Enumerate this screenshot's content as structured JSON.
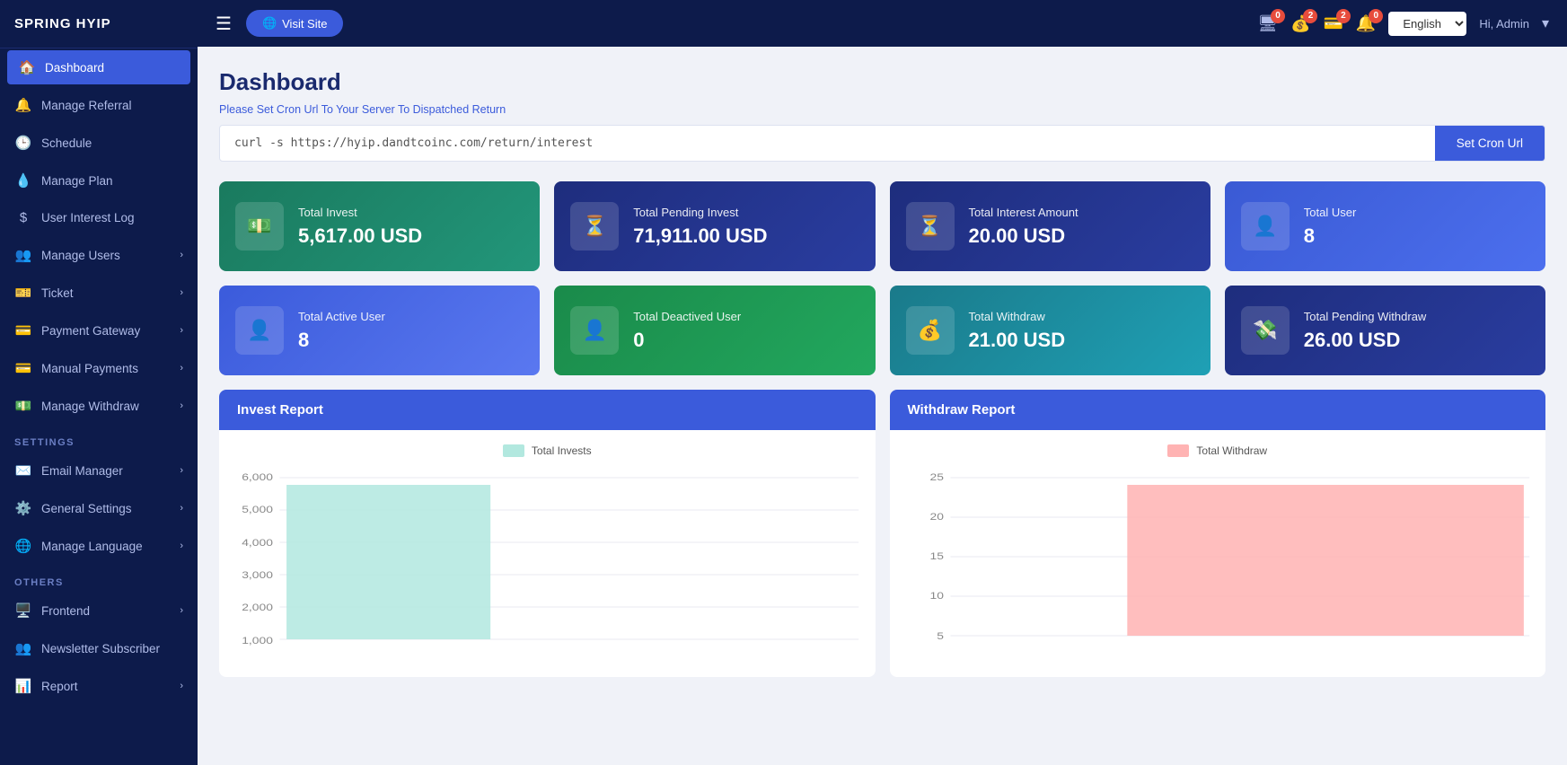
{
  "app": {
    "logo": "SPRING HYIP"
  },
  "sidebar": {
    "items": [
      {
        "id": "dashboard",
        "label": "Dashboard",
        "icon": "🏠",
        "active": true,
        "hasArrow": false
      },
      {
        "id": "manage-referral",
        "label": "Manage Referral",
        "icon": "🔔",
        "active": false,
        "hasArrow": false
      },
      {
        "id": "schedule",
        "label": "Schedule",
        "icon": "🕒",
        "active": false,
        "hasArrow": false
      },
      {
        "id": "manage-plan",
        "label": "Manage Plan",
        "icon": "💧",
        "active": false,
        "hasArrow": false
      },
      {
        "id": "user-interest-log",
        "label": "User Interest Log",
        "icon": "$",
        "active": false,
        "hasArrow": false
      },
      {
        "id": "manage-users",
        "label": "Manage Users",
        "icon": "👥",
        "active": false,
        "hasArrow": true
      },
      {
        "id": "ticket",
        "label": "Ticket",
        "icon": "🎫",
        "active": false,
        "hasArrow": true
      },
      {
        "id": "payment-gateway",
        "label": "Payment Gateway",
        "icon": "💳",
        "active": false,
        "hasArrow": true
      },
      {
        "id": "manual-payments",
        "label": "Manual Payments",
        "icon": "💳",
        "active": false,
        "hasArrow": true
      },
      {
        "id": "manage-withdraw",
        "label": "Manage Withdraw",
        "icon": "💵",
        "active": false,
        "hasArrow": true
      }
    ],
    "settings_label": "SETTINGS",
    "settings_items": [
      {
        "id": "email-manager",
        "label": "Email Manager",
        "icon": "✉️",
        "hasArrow": true
      },
      {
        "id": "general-settings",
        "label": "General Settings",
        "icon": "⚙️",
        "hasArrow": true
      },
      {
        "id": "manage-language",
        "label": "Manage Language",
        "icon": "🌐",
        "hasArrow": true
      }
    ],
    "others_label": "OTHERS",
    "others_items": [
      {
        "id": "frontend",
        "label": "Frontend",
        "icon": "🖥️",
        "hasArrow": true
      },
      {
        "id": "newsletter-subscriber",
        "label": "Newsletter Subscriber",
        "icon": "👥",
        "hasArrow": false
      },
      {
        "id": "report",
        "label": "Report",
        "icon": "📊",
        "hasArrow": true
      }
    ]
  },
  "topbar": {
    "visit_site_label": "Visit Site",
    "lang": "English",
    "admin_label": "Hi, Admin",
    "badges": {
      "monitor": 0,
      "wallet": 2,
      "card": 2,
      "bell": 0
    }
  },
  "content": {
    "page_title": "Dashboard",
    "cron_notice": "Please Set Cron Url To Your Server To Dispatched Return",
    "cron_command": "curl -s https://hyip.dandtcoinc.com/return/interest",
    "set_cron_label": "Set Cron Url",
    "stats": [
      {
        "id": "total-invest",
        "label": "Total Invest",
        "value": "5,617.00 USD",
        "icon": "💵",
        "color": "green"
      },
      {
        "id": "total-pending-invest",
        "label": "Total Pending Invest",
        "value": "71,911.00 USD",
        "icon": "⏳",
        "color": "dark-blue"
      },
      {
        "id": "total-interest-amount",
        "label": "Total Interest Amount",
        "value": "20.00 USD",
        "icon": "⏳",
        "color": "dark-blue"
      },
      {
        "id": "total-user",
        "label": "Total User",
        "value": "8",
        "icon": "👤",
        "color": "blue"
      },
      {
        "id": "total-active-user",
        "label": "Total Active User",
        "value": "8",
        "icon": "👤",
        "color": "medium-blue"
      },
      {
        "id": "total-deactivated-user",
        "label": "Total Deactived User",
        "value": "0",
        "icon": "👤❌",
        "color": "green2"
      },
      {
        "id": "total-withdraw",
        "label": "Total Withdraw",
        "value": "21.00 USD",
        "icon": "💰",
        "color": "teal"
      },
      {
        "id": "total-pending-withdraw",
        "label": "Total Pending Withdraw",
        "value": "26.00 USD",
        "icon": "💸",
        "color": "dark-blue"
      }
    ],
    "invest_report_label": "Invest Report",
    "withdraw_report_label": "Withdraw Report",
    "invest_chart": {
      "legend": "Total Invests",
      "y_labels": [
        "6,000",
        "5,000",
        "4,000",
        "3,000",
        "2,000",
        "1,000"
      ],
      "bar_height_pct": 83
    },
    "withdraw_chart": {
      "legend": "Total Withdraw",
      "y_labels": [
        "25",
        "20",
        "15",
        "10",
        "5"
      ],
      "bar_height_pct": 80
    }
  }
}
